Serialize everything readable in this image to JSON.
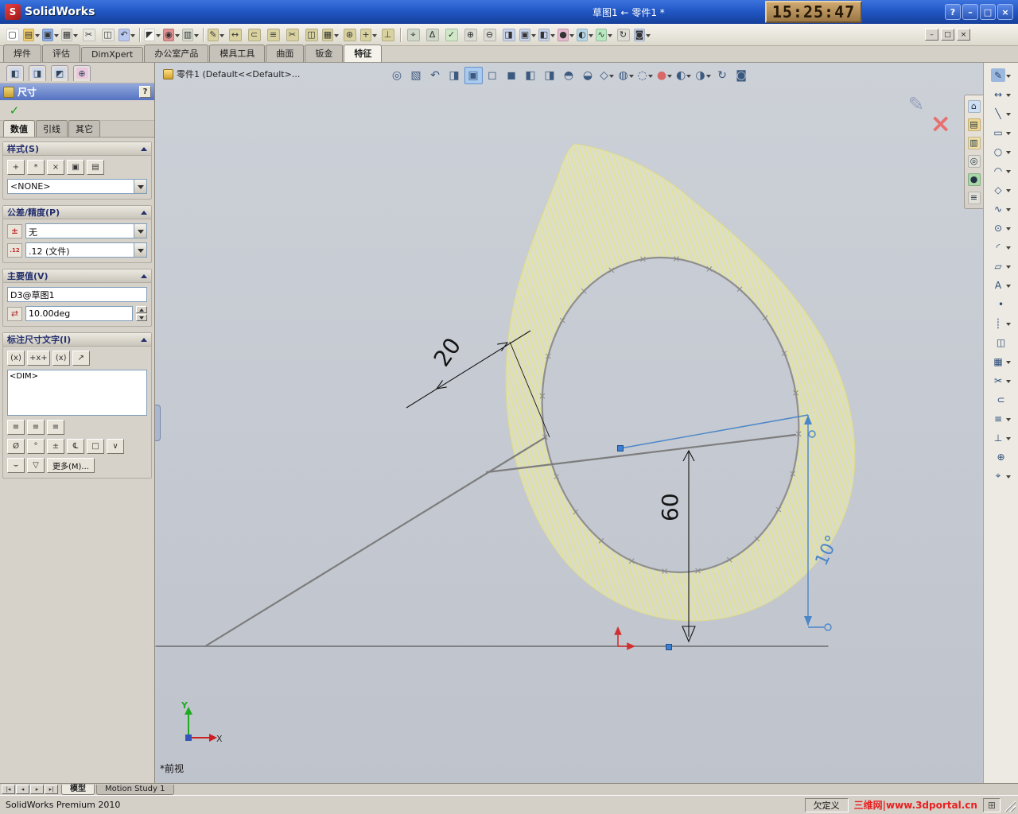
{
  "titlebar": {
    "app": "SolidWorks",
    "doc": "草图1 ← 零件1 *",
    "clock": "15:25:47",
    "help": "?",
    "minimize": "–",
    "maximize": "□",
    "close": "×"
  },
  "doc_controls": {
    "minimize": "–",
    "restore": "□",
    "close": "×"
  },
  "toolbar_main": {
    "icons": [
      {
        "name": "new-document-icon",
        "g": "▢",
        "c": "#ffffff"
      },
      {
        "name": "open-icon",
        "g": "▤",
        "c": "#f2cf6e",
        "a": 1
      },
      {
        "name": "save-icon",
        "g": "▣",
        "c": "#8fb0e8",
        "a": 1
      },
      {
        "name": "print-icon",
        "g": "▦",
        "c": "#e0e0d8",
        "a": 1
      },
      {
        "name": "cut-icon",
        "g": "✂",
        "c": "#e8e8e0"
      },
      {
        "name": "copy-icon",
        "g": "◫",
        "c": "#e8e8e0"
      },
      {
        "name": "undo-icon",
        "g": "↶",
        "c": "#b8c8f0",
        "a": 1
      },
      {
        "sep": 1,
        "name": "toolbar-separator"
      },
      {
        "name": "select-icon",
        "g": "◤",
        "c": "#f8f8f4",
        "a": 1
      },
      {
        "name": "rebuild-icon",
        "g": "◉",
        "c": "#e09090",
        "a": 1
      },
      {
        "name": "options-icon",
        "g": "▥",
        "c": "#d8dcd0",
        "a": 1
      },
      {
        "sep": 1,
        "name": "toolbar-separator"
      },
      {
        "name": "sketch-icon",
        "g": "✎",
        "c": "#d9d2a0",
        "a": 1
      },
      {
        "name": "smart-dimension-icon",
        "g": "↔",
        "c": "#d9d2a0"
      },
      {
        "name": "convert-entities-icon",
        "g": "⊂",
        "c": "#d9d2a0"
      },
      {
        "name": "offset-entities-icon",
        "g": "≡",
        "c": "#d9d2a0"
      },
      {
        "name": "trim-entities-icon",
        "g": "✂",
        "c": "#d9d2a0"
      },
      {
        "name": "mirror-entities-icon",
        "g": "◫",
        "c": "#d9d2a0"
      },
      {
        "name": "linear-pattern-icon",
        "g": "▦",
        "c": "#d9d2a0",
        "a": 1
      },
      {
        "name": "circular-pattern-icon",
        "g": "⊛",
        "c": "#d9d2a0"
      },
      {
        "name": "move-entities-icon",
        "g": "+",
        "c": "#d9d2a0",
        "a": 1
      },
      {
        "name": "display-relations-icon",
        "g": "⊥",
        "c": "#d9d2a0"
      },
      {
        "sep": 1,
        "name": "toolbar-separator"
      },
      {
        "name": "measure-icon",
        "g": "⌖",
        "c": "#cfd8c8"
      },
      {
        "name": "mass-properties-icon",
        "g": "Δ",
        "c": "#cfd8c8"
      },
      {
        "name": "check-icon",
        "g": "✓",
        "c": "#cfe8c8"
      },
      {
        "name": "zoom-in-icon",
        "g": "⊕",
        "c": "#dcdcd4"
      },
      {
        "name": "zoom-out-icon",
        "g": "⊖",
        "c": "#dcdcd4"
      },
      {
        "name": "section-view-icon",
        "g": "◨",
        "c": "#c8d4ec"
      },
      {
        "name": "view-orientation-icon",
        "g": "▣",
        "c": "#c8d4ec",
        "a": 1
      },
      {
        "name": "display-style-icon",
        "g": "◧",
        "c": "#c8d4ec",
        "a": 1
      },
      {
        "name": "appearance-icon",
        "g": "●",
        "c": "#e8b8d0",
        "a": 1
      },
      {
        "name": "scene-icon",
        "g": "◐",
        "c": "#b8d8e8",
        "a": 1
      },
      {
        "name": "spline-tools-icon",
        "g": "∿",
        "c": "#b8e8c0",
        "a": 1
      },
      {
        "name": "rotate-view-icon",
        "g": "↻",
        "c": "#dcdcd4"
      },
      {
        "name": "camera-icon",
        "g": "◙",
        "c": "#c8d4ec",
        "a": 1
      }
    ]
  },
  "command_tabs": [
    {
      "label": "焊件",
      "name": "tab-weldments"
    },
    {
      "label": "评估",
      "name": "tab-evaluate"
    },
    {
      "label": "DimXpert",
      "name": "tab-dimxpert"
    },
    {
      "label": "办公室产品",
      "name": "tab-office-products"
    },
    {
      "label": "模具工具",
      "name": "tab-mold-tools"
    },
    {
      "label": "曲面",
      "name": "tab-surfaces"
    },
    {
      "label": "钣金",
      "name": "tab-sheet-metal"
    },
    {
      "label": "特征",
      "name": "tab-features",
      "active": 1
    }
  ],
  "pm": {
    "tab_icons": [
      {
        "name": "feature-manager-tab-icon",
        "g": "◧",
        "c": "#d0d8ec"
      },
      {
        "name": "property-manager-tab-icon",
        "g": "◨",
        "c": "#d0d8ec"
      },
      {
        "name": "configuration-manager-tab-icon",
        "g": "◩",
        "c": "#d0d8ec"
      },
      {
        "name": "dimxpert-manager-tab-icon",
        "g": "⊕",
        "c": "#ecc8e0"
      }
    ],
    "title": "尺寸",
    "help": "?",
    "ok": "✓",
    "tabs": [
      {
        "label": "数值",
        "name": "pm-tab-value",
        "active": 1
      },
      {
        "label": "引线",
        "name": "pm-tab-leaders"
      },
      {
        "label": "其它",
        "name": "pm-tab-other"
      }
    ],
    "style": {
      "header": "样式(S)",
      "buttons": [
        {
          "name": "apply-default-style-button",
          "g": "+"
        },
        {
          "name": "add-style-button",
          "g": "*"
        },
        {
          "name": "delete-style-button",
          "g": "×"
        },
        {
          "name": "save-style-button",
          "g": "▣"
        },
        {
          "name": "load-style-button",
          "g": "▤"
        }
      ],
      "dropdown": "<NONE>"
    },
    "tolerance": {
      "header": "公差/精度(P)",
      "type": "无",
      "precision": ".12 (文件)"
    },
    "primary": {
      "header": "主要值(V)",
      "dim_name": "D3@草图1",
      "value": "10.00deg"
    },
    "dimtext": {
      "header": "标注尺寸文字(I)",
      "buttons": [
        {
          "name": "parenthesis-button",
          "g": "(x)"
        },
        {
          "name": "center-text-button",
          "g": "+x+"
        },
        {
          "name": "offset-text-button",
          "g": "(x)"
        },
        {
          "name": "leader-text-button",
          "g": "↗"
        }
      ],
      "text": "<DIM>",
      "align": [
        {
          "name": "align-left-button",
          "g": "≡"
        },
        {
          "name": "align-center-button",
          "g": "≡"
        },
        {
          "name": "align-right-button",
          "g": "≡"
        }
      ],
      "symbols": [
        {
          "name": "diameter-symbol-button",
          "g": "Ø"
        },
        {
          "name": "degree-symbol-button",
          "g": "°"
        },
        {
          "name": "plus-minus-symbol-button",
          "g": "±"
        },
        {
          "name": "centerline-symbol-button",
          "g": "℄"
        },
        {
          "name": "square-symbol-button",
          "g": "□"
        },
        {
          "name": "more-symbols-button",
          "g": "∨"
        }
      ],
      "row3": [
        {
          "name": "arc-length-button",
          "g": "⌣"
        },
        {
          "name": "inspection-dimension-button",
          "g": "▽"
        }
      ],
      "more": "更多(M)..."
    }
  },
  "viewport": {
    "tree_root": "零件1 (Default<<Default>...",
    "view_label": "*前视",
    "triad": {
      "x": "X",
      "y": "Y"
    },
    "dims": {
      "d20": "20",
      "d60": "60",
      "d10": "10°"
    },
    "hud": [
      {
        "name": "zoom-fit-icon",
        "g": "◎"
      },
      {
        "name": "zoom-area-icon",
        "g": "▧"
      },
      {
        "name": "zoom-previous-icon",
        "g": "↶"
      },
      {
        "name": "section-view-icon",
        "g": "◨"
      },
      {
        "name": "view-orientation-icon",
        "g": "▣",
        "active": 1
      },
      {
        "name": "front-view-icon",
        "g": "◻"
      },
      {
        "name": "back-view-icon",
        "g": "◼"
      },
      {
        "name": "left-view-icon",
        "g": "◧"
      },
      {
        "name": "right-view-icon",
        "g": "◨"
      },
      {
        "name": "top-view-icon",
        "g": "◓"
      },
      {
        "name": "bottom-view-icon",
        "g": "◒"
      },
      {
        "name": "isometric-view-icon",
        "g": "◇",
        "a": 1
      },
      {
        "name": "display-style-icon",
        "g": "◍",
        "a": 1
      },
      {
        "name": "hide-show-items-icon",
        "g": "◌",
        "a": 1
      },
      {
        "name": "edit-appearance-icon",
        "g": "●",
        "c": "#d86868",
        "a": 1
      },
      {
        "name": "apply-scene-icon",
        "g": "◐",
        "a": 1
      },
      {
        "name": "view-settings-icon",
        "g": "◑",
        "a": 1
      },
      {
        "name": "rotate-view-icon",
        "g": "↻"
      },
      {
        "name": "camera-icon",
        "g": "◙"
      }
    ]
  },
  "taskpane": [
    {
      "name": "solidworks-resources-icon",
      "g": "⌂",
      "c": "#cfe0f4"
    },
    {
      "name": "design-library-icon",
      "g": "▤",
      "c": "#f0d890"
    },
    {
      "name": "file-explorer-icon",
      "g": "▥",
      "c": "#f0e0a8"
    },
    {
      "name": "search-icon",
      "g": "◎",
      "c": "#e0e0d8"
    },
    {
      "name": "appearances-icon",
      "g": "●",
      "c": "#a8d8a8"
    },
    {
      "name": "custom-properties-icon",
      "g": "≡",
      "c": "#e0e0d8"
    }
  ],
  "right_toolbar": [
    {
      "name": "sketch-icon",
      "g": "✎",
      "c": "#9cb8dc",
      "a": 1
    },
    {
      "name": "smart-dimension-icon",
      "g": "↔",
      "a": 1
    },
    {
      "name": "line-icon",
      "g": "╲",
      "a": 1
    },
    {
      "name": "rectangle-icon",
      "g": "▭",
      "a": 1
    },
    {
      "name": "circle-icon",
      "g": "○",
      "a": 1
    },
    {
      "name": "arc-icon",
      "g": "◠",
      "a": 1
    },
    {
      "name": "polygon-icon",
      "g": "◇",
      "a": 1
    },
    {
      "name": "spline-icon",
      "g": "∿",
      "a": 1
    },
    {
      "name": "ellipse-icon",
      "g": "⊙",
      "a": 1
    },
    {
      "name": "fillet-icon",
      "g": "◜",
      "a": 1
    },
    {
      "name": "plane-icon",
      "g": "▱",
      "a": 1
    },
    {
      "name": "text-icon",
      "g": "A",
      "a": 1
    },
    {
      "name": "point-icon",
      "g": "•"
    },
    {
      "name": "centerline-icon",
      "g": "┊",
      "a": 1
    },
    {
      "name": "mirror-icon",
      "g": "◫"
    },
    {
      "name": "pattern-icon",
      "g": "▦",
      "a": 1
    },
    {
      "name": "trim-icon",
      "g": "✂",
      "a": 1
    },
    {
      "name": "convert-icon",
      "g": "⊂"
    },
    {
      "name": "offset-icon",
      "g": "≡",
      "a": 1
    },
    {
      "name": "relations-icon",
      "g": "⊥",
      "a": 1
    },
    {
      "name": "repair-sketch-icon",
      "g": "⊕"
    },
    {
      "name": "quick-snaps-icon",
      "g": "⌖",
      "a": 1
    }
  ],
  "bottom": {
    "nav": [
      {
        "name": "first-tab-button",
        "g": "|◂"
      },
      {
        "name": "prev-tab-button",
        "g": "◂"
      },
      {
        "name": "next-tab-button",
        "g": "▸"
      },
      {
        "name": "last-tab-button",
        "g": "▸|"
      }
    ],
    "tabs": [
      {
        "label": "模型",
        "name": "tab-model",
        "active": 1
      },
      {
        "label": "Motion Study 1",
        "name": "tab-motion-study-1"
      }
    ]
  },
  "statusbar": {
    "app": "SolidWorks Premium 2010",
    "state": "欠定义",
    "watermark": "三维网|www.3dportal.cn"
  }
}
